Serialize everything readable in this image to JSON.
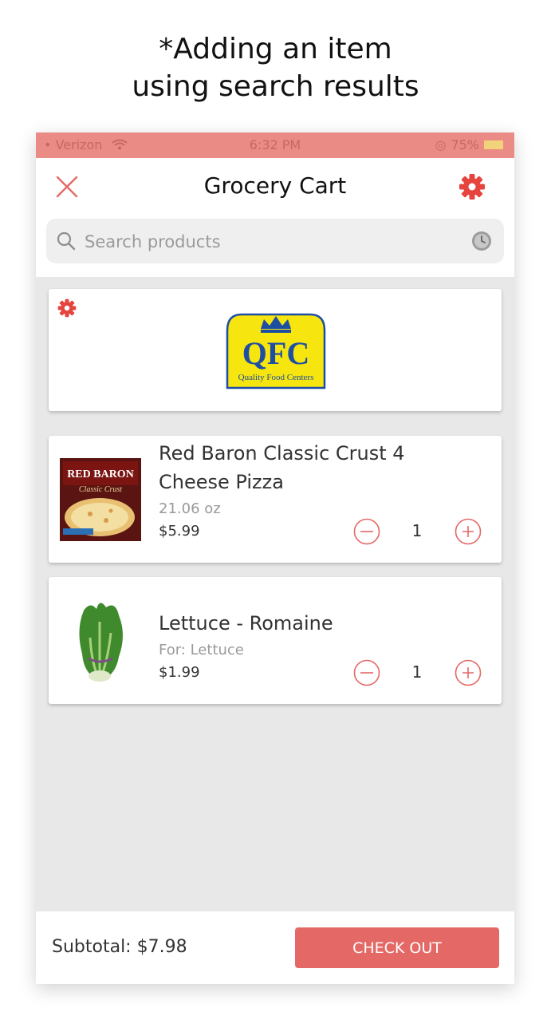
{
  "caption": {
    "line1": "*Adding an item",
    "line2": "using search results"
  },
  "status": {
    "carrier": "Verizon",
    "time": "6:32 PM",
    "battery": "75%"
  },
  "header": {
    "title": "Grocery Cart"
  },
  "search": {
    "placeholder": "Search products"
  },
  "store": {
    "logo_text": "QFC",
    "logo_subtext": "Quality Food Centers"
  },
  "items": [
    {
      "name": "Red Baron Classic Crust 4 Cheese Pizza",
      "subtitle": "21.06 oz",
      "price": "$5.99",
      "qty": "1",
      "box_brand": "RED BARON",
      "box_line": "Classic Crust"
    },
    {
      "name": "Lettuce - Romaine",
      "subtitle": "For: Lettuce",
      "price": "$1.99",
      "qty": "1"
    }
  ],
  "footer": {
    "subtotal": "Subtotal: $7.98",
    "checkout": "CHECK OUT"
  },
  "colors": {
    "accent": "#e46966",
    "statusbar": "#eb8b86",
    "logo_yellow": "#f6e50f",
    "logo_blue": "#1e4ea3"
  },
  "icons": [
    "close-icon",
    "gear-icon",
    "search-icon",
    "clock-icon",
    "minus-icon",
    "plus-icon",
    "wifi-icon"
  ]
}
